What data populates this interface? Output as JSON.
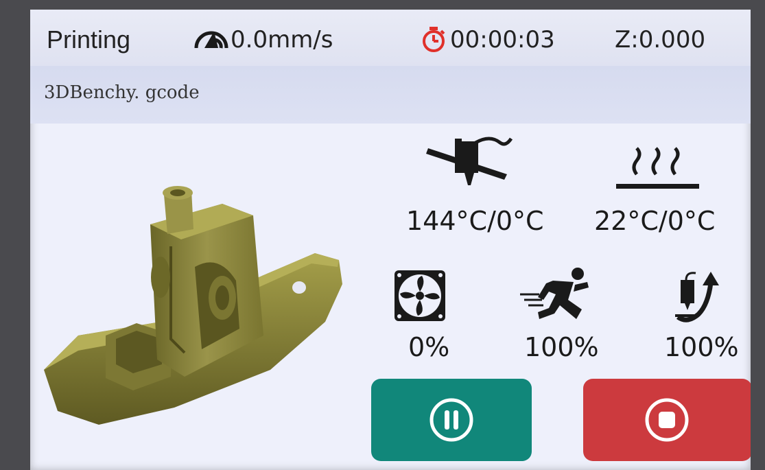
{
  "status": {
    "state": "Printing",
    "speed": "0.0mm/s",
    "elapsed": "00:00:03",
    "z": "Z:0.000",
    "speed_icon": "speedometer-icon",
    "timer_icon": "stopwatch-icon"
  },
  "file": {
    "name": "3DBenchy. gcode"
  },
  "readouts": {
    "nozzle_temp": "144°C/0°C",
    "bed_temp": "22°C/0°C",
    "fan": "0%",
    "speed_factor": "100%",
    "flow": "100%"
  },
  "icons": {
    "nozzle": "hotend-nozzle-icon",
    "bed": "heated-bed-icon",
    "fan": "fan-icon",
    "speed": "running-person-icon",
    "flow": "extruder-flow-icon"
  },
  "buttons": {
    "pause": "pause-button",
    "stop": "stop-button"
  },
  "colors": {
    "pause_button": "#11877a",
    "stop_button": "#cc3a3e",
    "timer_icon": "#e0302a",
    "screen_background": "#eef0fb",
    "model_color": "#8f8a3c"
  }
}
